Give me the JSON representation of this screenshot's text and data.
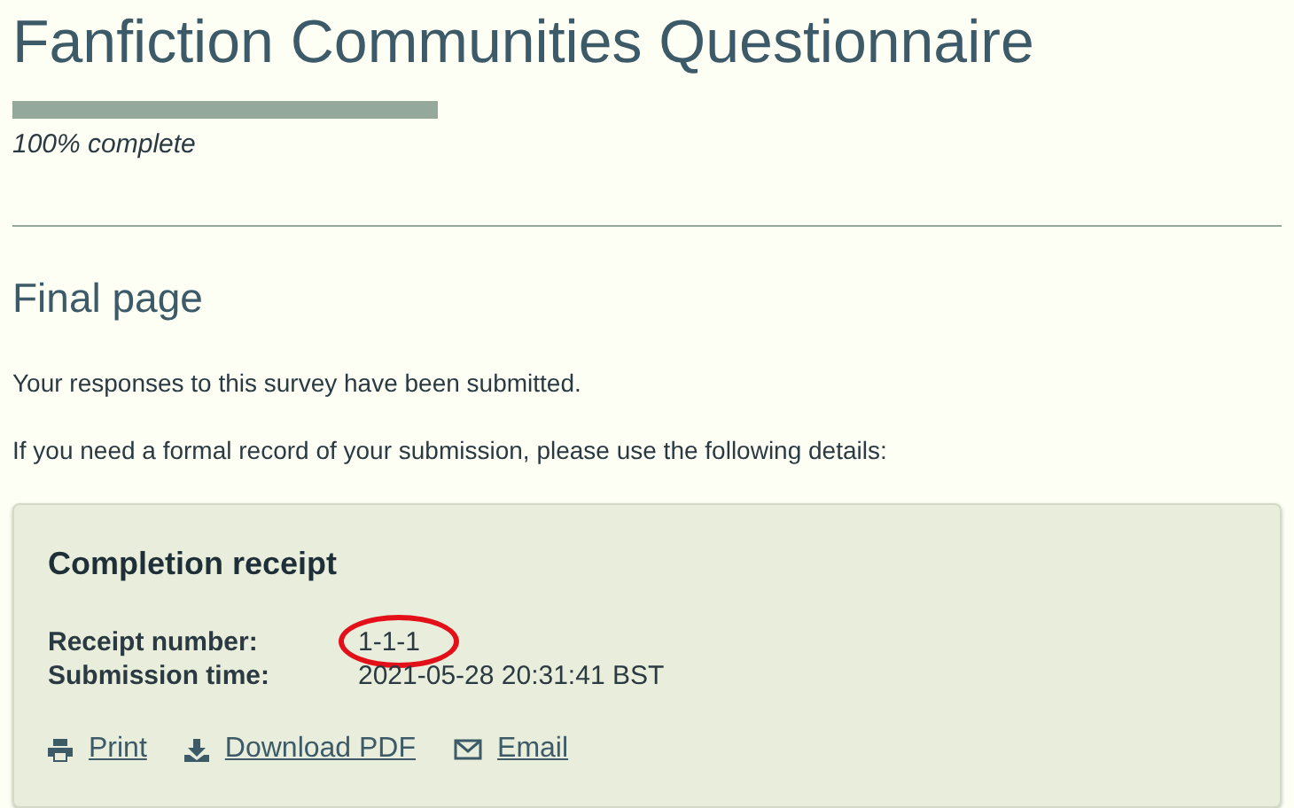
{
  "title": "Fanfiction Communities Questionnaire",
  "progress": {
    "level": 1,
    "label": "100% complete"
  },
  "section_title": "Final page",
  "paragraphs": [
    "Your responses to this survey have been submitted.",
    "If you need a formal record of your submission, please use the following details:"
  ],
  "receipt": {
    "title": "Completion receipt",
    "fields": [
      {
        "label": "Receipt number:",
        "value": "1-1-1",
        "circled": true
      },
      {
        "label": "Submission time:",
        "value": "2021-05-28 20:31:41 BST",
        "circled": false
      }
    ],
    "actions": [
      {
        "kind": "print",
        "label": "Print"
      },
      {
        "kind": "download",
        "label": "Download PDF"
      },
      {
        "kind": "email",
        "label": "Email"
      }
    ]
  }
}
